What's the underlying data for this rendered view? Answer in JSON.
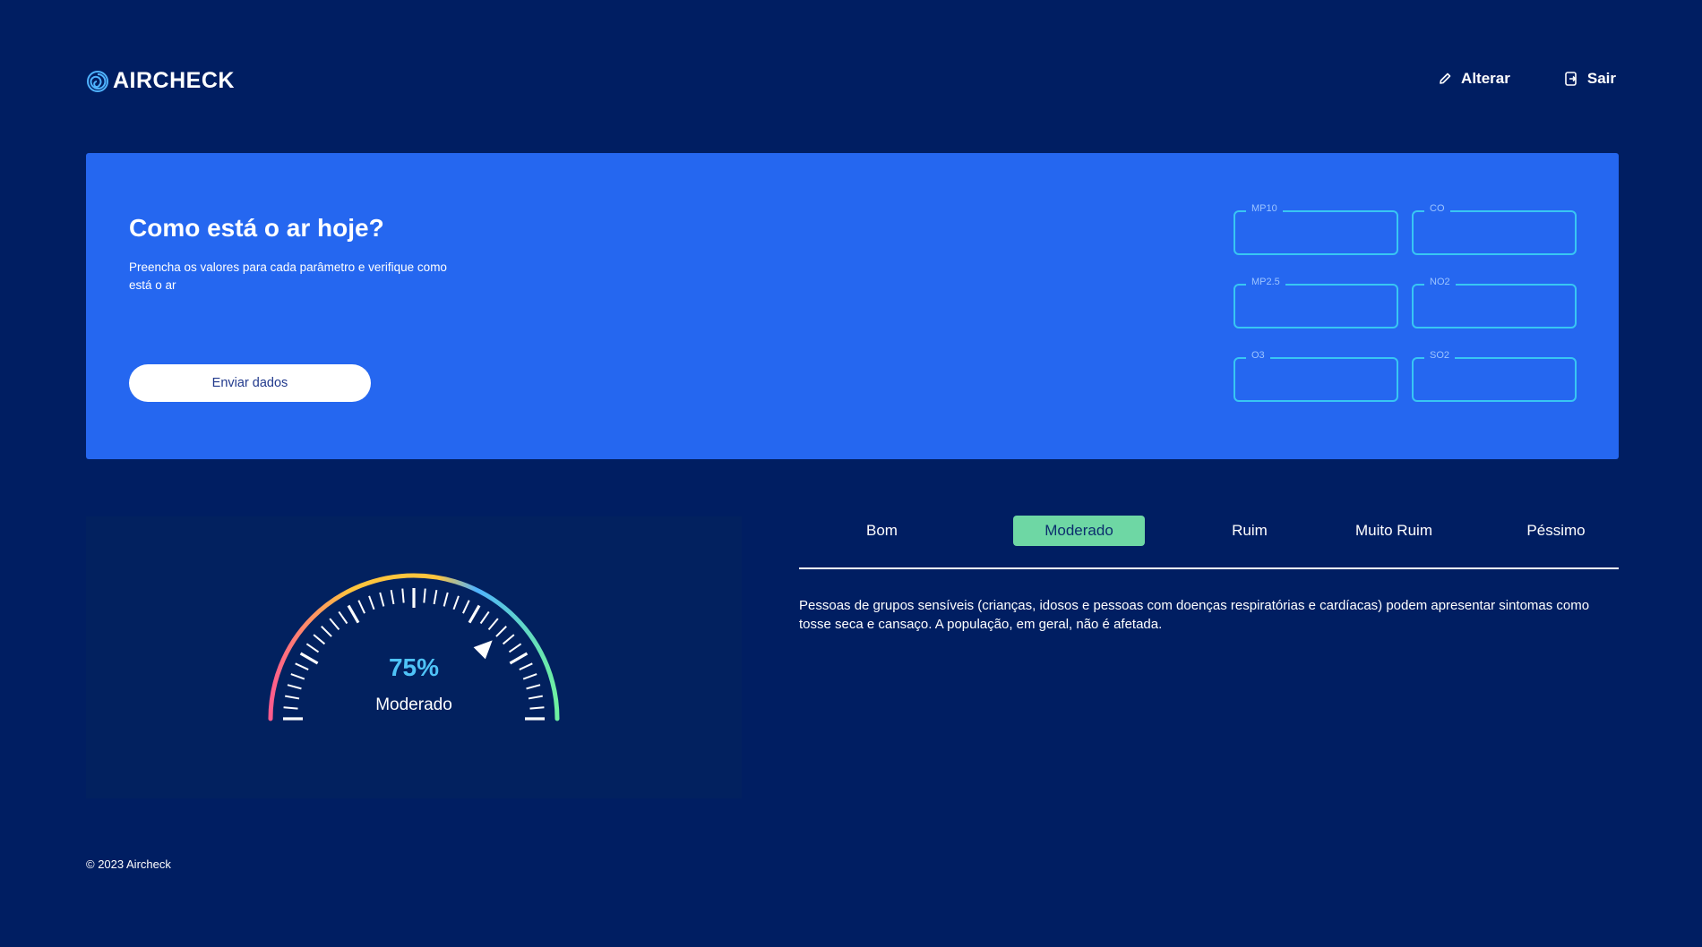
{
  "header": {
    "logo_text": "AIRCHECK",
    "nav": {
      "edit_label": "Alterar",
      "logout_label": "Sair"
    }
  },
  "hero": {
    "title": "Como está o ar hoje?",
    "subtitle": "Preencha os valores para cada parâmetro e verifique como está o ar",
    "submit_label": "Enviar dados",
    "fields": [
      {
        "label": "MP10",
        "value": ""
      },
      {
        "label": "CO",
        "value": ""
      },
      {
        "label": "MP2.5",
        "value": ""
      },
      {
        "label": "NO2",
        "value": ""
      },
      {
        "label": "O3",
        "value": ""
      },
      {
        "label": "SO2",
        "value": ""
      }
    ]
  },
  "gauge": {
    "percent": 75,
    "percent_text": "75%",
    "status_label": "Moderado",
    "colors": {
      "pink": "#ff5b8d",
      "yellow": "#ffc53d",
      "blue": "#4fb3ff",
      "green": "#6ef0a0",
      "value": "#4fc3f7"
    }
  },
  "categories": {
    "tabs": [
      "Bom",
      "Moderado",
      "Ruim",
      "Muito Ruim",
      "Péssimo"
    ],
    "active_index": 1,
    "description": "Pessoas de grupos sensíveis (crianças, idosos e pessoas com doenças respiratórias e cardíacas) podem apresentar sintomas como tosse seca e cansaço. A população, em geral, não é afetada."
  },
  "footer": {
    "copyright": "© 2023 Aircheck"
  },
  "colors": {
    "background": "#001e62",
    "hero": "#2567f0",
    "field_border": "#38c6f3",
    "active_tab": "#6ed7a4"
  }
}
